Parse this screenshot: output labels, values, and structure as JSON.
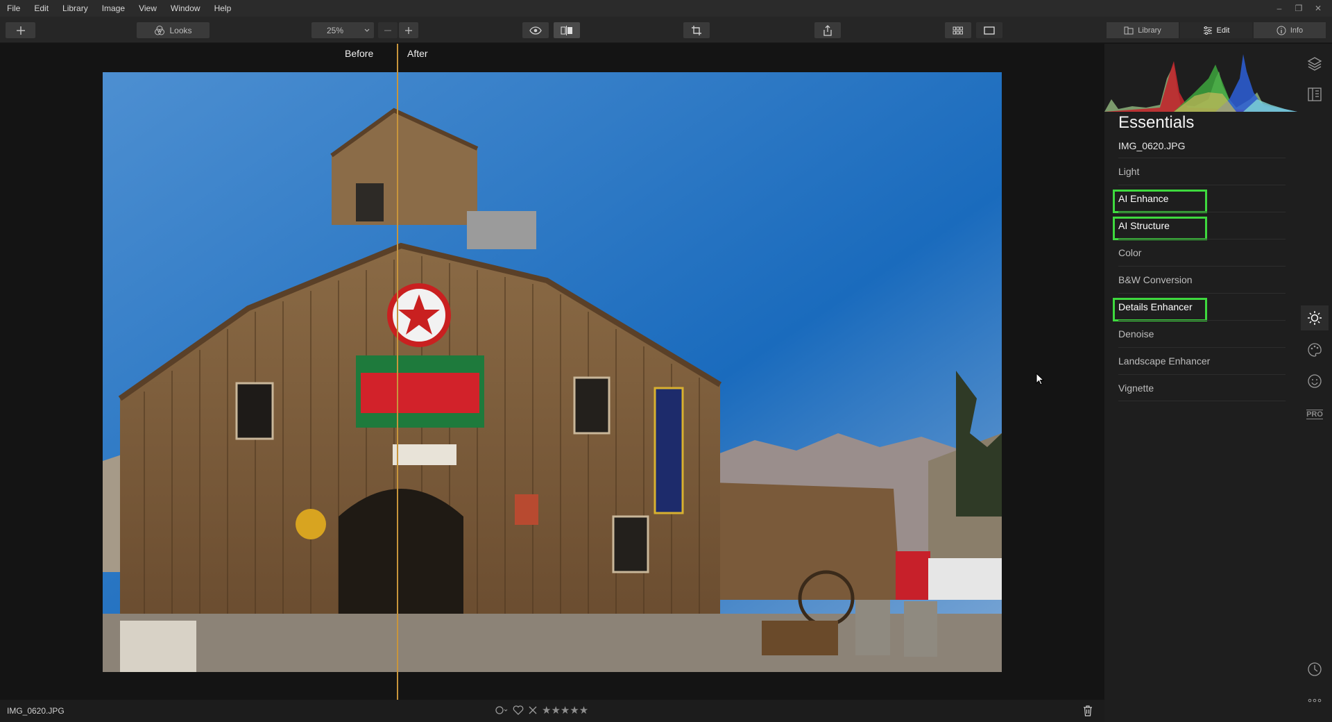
{
  "menu": {
    "items": [
      "File",
      "Edit",
      "Library",
      "Image",
      "View",
      "Window",
      "Help"
    ]
  },
  "toolbar": {
    "looks_label": "Looks",
    "zoom_value": "25%"
  },
  "mode_tabs": [
    {
      "label": "Library",
      "icon": "library-icon"
    },
    {
      "label": "Edit",
      "icon": "sliders-icon"
    },
    {
      "label": "Info",
      "icon": "info-icon"
    }
  ],
  "canvas": {
    "before_label": "Before",
    "after_label": "After"
  },
  "status": {
    "filename": "IMG_0620.JPG",
    "stars": "★★★★★"
  },
  "panel": {
    "title": "Essentials",
    "filename": "IMG_0620.JPG",
    "filters": [
      {
        "label": "Light",
        "highlight": false
      },
      {
        "label": "AI Enhance",
        "highlight": true
      },
      {
        "label": "AI Structure",
        "highlight": true
      },
      {
        "label": "Color",
        "highlight": false
      },
      {
        "label": "B&W Conversion",
        "highlight": false
      },
      {
        "label": "Details Enhancer",
        "highlight": true
      },
      {
        "label": "Denoise",
        "highlight": false
      },
      {
        "label": "Landscape Enhancer",
        "highlight": false
      },
      {
        "label": "Vignette",
        "highlight": false
      }
    ]
  },
  "icons": {
    "pro_label": "PRO"
  },
  "colors": {
    "highlight_outline": "#3ed93e",
    "split_line": "#c8953c"
  }
}
